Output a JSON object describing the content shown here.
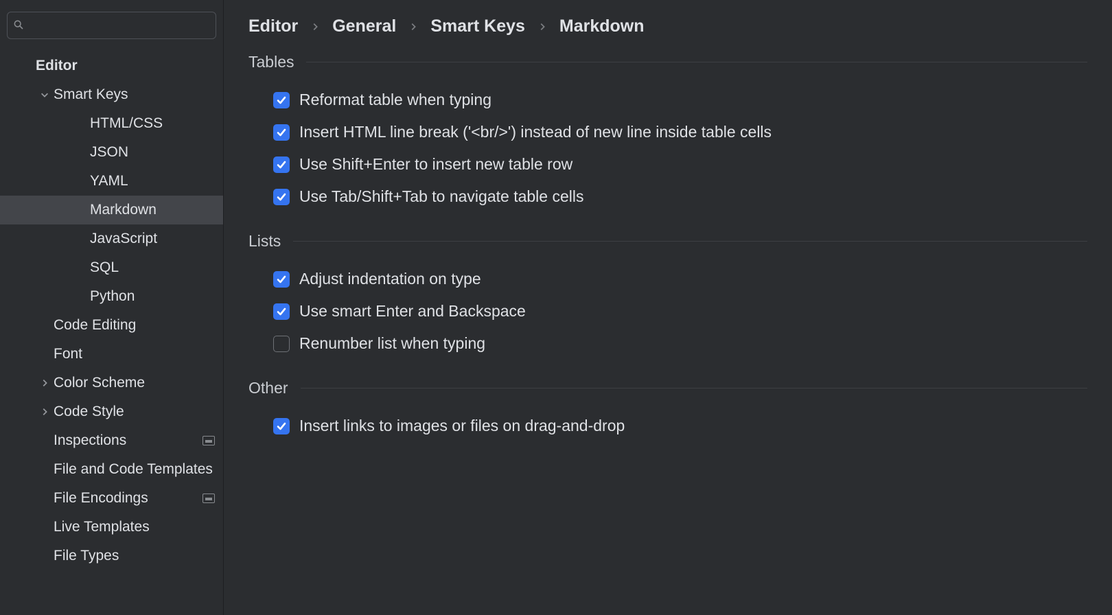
{
  "search": {
    "placeholder": ""
  },
  "sidebar": {
    "root": "Editor",
    "smartKeys": {
      "label": "Smart Keys",
      "expanded": true
    },
    "children": [
      "HTML/CSS",
      "JSON",
      "YAML",
      "Markdown",
      "JavaScript",
      "SQL",
      "Python"
    ],
    "selectedChild": "Markdown",
    "items": [
      {
        "label": "Code Editing",
        "chevron": false,
        "badge": false
      },
      {
        "label": "Font",
        "chevron": false,
        "badge": false
      },
      {
        "label": "Color Scheme",
        "chevron": true,
        "badge": false
      },
      {
        "label": "Code Style",
        "chevron": true,
        "badge": false
      },
      {
        "label": "Inspections",
        "chevron": false,
        "badge": true
      },
      {
        "label": "File and Code Templates",
        "chevron": false,
        "badge": false
      },
      {
        "label": "File Encodings",
        "chevron": false,
        "badge": true
      },
      {
        "label": "Live Templates",
        "chevron": false,
        "badge": false
      },
      {
        "label": "File Types",
        "chevron": false,
        "badge": false
      }
    ]
  },
  "breadcrumb": [
    "Editor",
    "General",
    "Smart Keys",
    "Markdown"
  ],
  "sections": [
    {
      "title": "Tables",
      "options": [
        {
          "label": "Reformat table when typing",
          "checked": true
        },
        {
          "label": "Insert HTML line break ('<br/>') instead of new line inside table cells",
          "checked": true
        },
        {
          "label": "Use Shift+Enter to insert new table row",
          "checked": true
        },
        {
          "label": "Use Tab/Shift+Tab to navigate table cells",
          "checked": true
        }
      ]
    },
    {
      "title": "Lists",
      "options": [
        {
          "label": "Adjust indentation on type",
          "checked": true
        },
        {
          "label": "Use smart Enter and Backspace",
          "checked": true
        },
        {
          "label": "Renumber list when typing",
          "checked": false
        }
      ]
    },
    {
      "title": "Other",
      "options": [
        {
          "label": "Insert links to images or files on drag-and-drop",
          "checked": true
        }
      ]
    }
  ]
}
